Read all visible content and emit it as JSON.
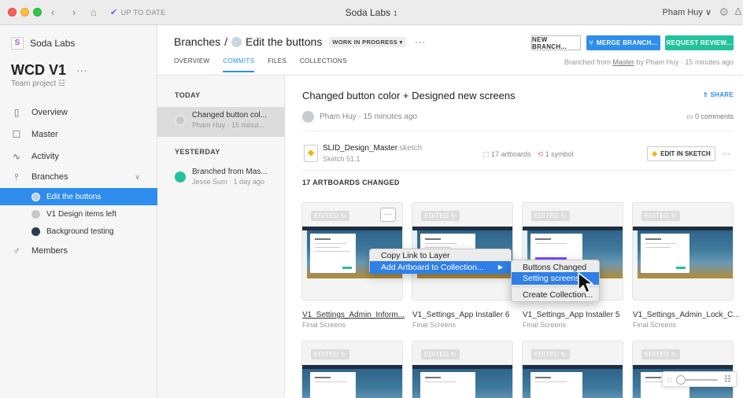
{
  "titlebar": {
    "status": "UP TO DATE",
    "app_title": "Soda Labs ↕",
    "user": "Pham Huy ∨"
  },
  "sidebar": {
    "workspace": "Soda Labs",
    "project_title": "WCD V1",
    "project_menu": "···",
    "project_sub": "Team project ☷",
    "items": [
      {
        "label": "Overview",
        "icon": "document-icon"
      },
      {
        "label": "Master",
        "icon": "master-icon"
      },
      {
        "label": "Activity",
        "icon": "activity-icon"
      },
      {
        "label": "Branches",
        "icon": "branch-icon"
      },
      {
        "label": "Members",
        "icon": "person-icon"
      }
    ],
    "branches": [
      {
        "label": "Edit the buttons",
        "active": true
      },
      {
        "label": "V1 Design items left",
        "active": false
      },
      {
        "label": "Background testing",
        "active": false
      }
    ]
  },
  "header": {
    "crumb_root": "Branches",
    "crumb_sep": "/",
    "crumb_branch": "Edit the buttons",
    "status_badge": "WORK IN PROGRESS ▾",
    "more": "···",
    "btn_new": "NEW BRANCH...",
    "btn_merge": "MERGE BRANCH...",
    "btn_review": "REQUEST REVIEW...",
    "tabs": [
      "OVERVIEW",
      "COMMITS",
      "FILES",
      "COLLECTIONS"
    ],
    "branched_prefix": "Branched from ",
    "branched_link": "Master",
    "branched_suffix": " by Pham Huy · 15 minutes ago"
  },
  "commits": {
    "today_label": "TODAY",
    "yesterday_label": "YESTERDAY",
    "today": [
      {
        "title": "Changed button col...",
        "meta": "Pham Huy · 15 minut..."
      }
    ],
    "yesterday": [
      {
        "title": "Branched from Mas...",
        "meta": "Jesse Sum · 1 day ago"
      }
    ]
  },
  "commit_detail": {
    "title": "Changed button color + Designed new screens",
    "share": "SHARE",
    "author": "Pham Huy · 15 minutes ago",
    "comments": "0 comments",
    "file_name": "SLID_Design_Master",
    "file_ext": ".sketch",
    "file_version": "Sketch 51.1",
    "artboards": "17 artboards",
    "symbols": "1 symbol",
    "edit_btn": "EDIT IN SKETCH",
    "file_more": "···",
    "changed_label": "17 ARTBOARDS CHANGED"
  },
  "artboards": [
    {
      "badge": "EDITED ↻",
      "title": "V1_Settings_Admin_Inform...",
      "sub": "Final Screens"
    },
    {
      "badge": "EDITED ↻",
      "title": "V1_Settings_App Installer 6",
      "sub": "Final Screens"
    },
    {
      "badge": "EDITED ↻",
      "title": "V1_Settings_App Installer 5",
      "sub": "Final Screens"
    },
    {
      "badge": "EDITED ↻",
      "title": "V1_Settings_Admin_Lock_C...",
      "sub": "Final Screens"
    },
    {
      "badge": "EDITED ↻"
    },
    {
      "badge": "EDITED ↻"
    },
    {
      "badge": "EDITED ↻"
    },
    {
      "badge": "EDITED ↻"
    }
  ],
  "context_menu": {
    "items": [
      "Copy Link to Layer",
      "Add Artboard to Collection..."
    ],
    "submenu": [
      "Buttons Changed",
      "Setting screens",
      "Create Collection..."
    ],
    "highlight_color": "#2f7fe6"
  },
  "colors": {
    "accent": "#2f8ded",
    "review": "#23c29c"
  }
}
